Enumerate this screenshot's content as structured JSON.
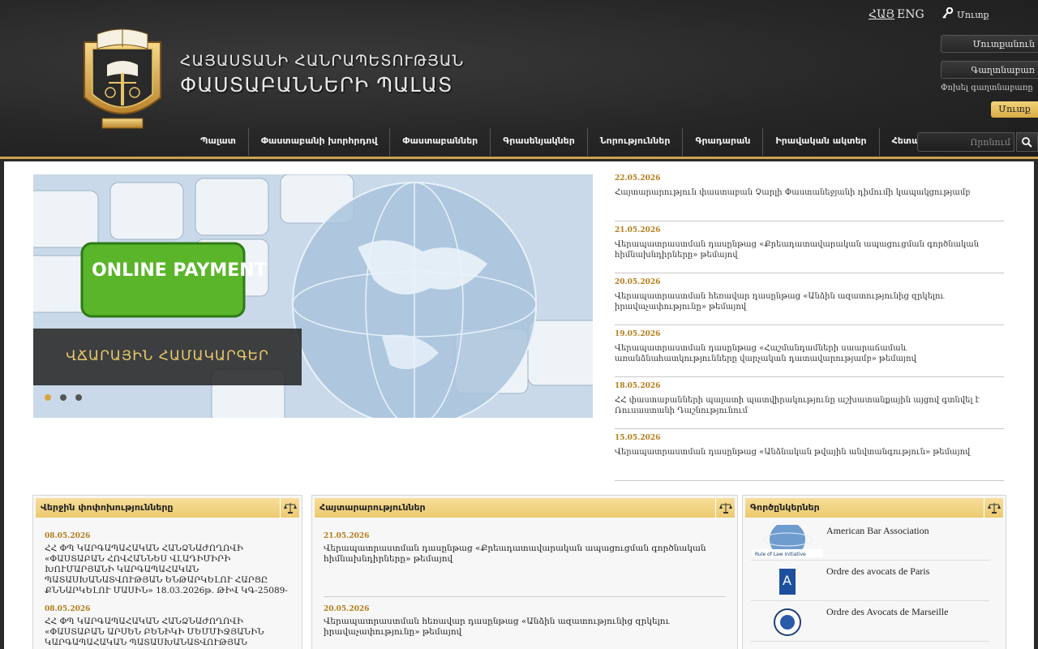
{
  "header": {
    "title_line1": "ՀԱՅԱՍՏԱՆԻ ՀԱՆՐԱՊԵՏՈՒԹՅԱՆ",
    "title_line2": "ՓԱՍՏԱԲԱՆՆԵՐԻ ՊԱԼԱՏ",
    "lang_hy": "ՀԱՅ",
    "lang_en": "ENG",
    "login_top": "Մուտք",
    "login_field": "Մուտքանուն",
    "password_field": "Գաղտնաբառ",
    "forgot": "Փոխել գաղտնաբառը",
    "enter_button": "Մուտք",
    "search_placeholder": "Որոնում"
  },
  "nav": [
    "Պալատ",
    "Փաստաբանի խորհրդով",
    "Փաստաբաններ",
    "Գրասենյակներ",
    "Նորություններ",
    "Գրադարան",
    "Իրավական ակտեր",
    "Հետադարձ կապ"
  ],
  "slider": {
    "caption": "ՎՃԱՐԱՅԻՆ ՀԱՄԱԿԱՐԳԵՐ",
    "keyboard_text": "ONLINE PAYMENT",
    "slides_count": 3,
    "active_slide": 1
  },
  "news": [
    {
      "date": "22.05.2026",
      "title": "Հայտարարություն փաստաբան Չարլի Փաստանեջյանի դիմումի կապակցությամբ"
    },
    {
      "date": "21.05.2026",
      "title": "Վերապատրաստման դասընթաց «Քրեադատավարական ապացուցման գործնական հիմնախնդիրները» թեմայով"
    },
    {
      "date": "20.05.2026",
      "title": "Վերապատրաստման հեռավար դասընթաց «Անձին ազատությունից զրկելու իրավաչափությունը» թեմայով"
    },
    {
      "date": "19.05.2026",
      "title": "Վերապատրաստման դասընթաց «Հաշմանդամների սաարաճամաև առանձնահատկությունները վարչական դատավարությամբ» թեմայով"
    },
    {
      "date": "18.05.2026",
      "title": "ՀՀ փաստաբանների պալատի պատվիրակությունը աշխատանքային այցով գտնվել է Ռուսաստանի Դաշնությունում"
    },
    {
      "date": "15.05.2026",
      "title": "Վերապատրաստման դասընթաց «Անձնական թվային անվտանգություն» թեմայով"
    }
  ],
  "panels": {
    "changes": {
      "title": "Վերջին փոփոխությունները",
      "items": [
        {
          "date": "08.05.2026",
          "text": "ՀՀ ՓՊ ԿԱՐԳԱՊԱՀԱԿԱՆ ՀԱՆՁՆԱԺՈՂՈՎԻ «ՓԱՍՏԱԲԱՆ ՀՈՎՀԱՆՆԵՍ ՎԼԱԴԻՄԻՐԻ ԽՈՒՄԱՐՅԱՆԻ ԿԱՐԳԱՊԱՀԱԿԱՆ ՊԱՏԱՍԽԱՆԱՏՎՈՒԹՅԱՆ ԵՆԹԱՐԿԵԼՈՒ ՀԱՐՑԸ ՔՆՆԱՐԿԵԼՈՒ ՄԱՍԻՆ» 18.03.2026թ. ԹԻՎ ԿԳ-25089-"
        },
        {
          "date": "08.05.2026",
          "text": "ՀՀ ՓՊ ԿԱՐԳԱՊԱՀԱԿԱՆ ՀԱՆՁՆԱԺՈՂՈՎԻ «ՓԱՍՏԱԲԱՆ ԱՐՍԵՆ ԲԵՆԻԿԻ ՄԵՄՄԻՋՅԱՆԻՆ ԿԱՐԳԱՊԱՀԱԿԱՆ ՊԱՏԱՍԽԱՆԱՏՎՈՒԹՅԱՆ"
        }
      ]
    },
    "announcements": {
      "title": "Հայտարարություններ",
      "items": [
        {
          "date": "21.05.2026",
          "text": "Վերապատրաստման դասընթաց «Քրեադատավարական ապացուցման գործնական հիմնախնդիրները» թեմայով"
        },
        {
          "date": "20.05.2026",
          "text": "Վերապատրաստման հեռավար դասընթաց «Անձին ազատությունից զրկելու իրավաչափությունը» թեմայով"
        }
      ]
    },
    "partners": {
      "title": "Գործընկերներ",
      "items": [
        {
          "name": "American Bar Association",
          "logo_text": "Rule of Law Initiative"
        },
        {
          "name": "Ordre des avocats de Paris",
          "logo_text": "A"
        },
        {
          "name": "Ordre des Avocats de Marseille",
          "logo_text": ""
        }
      ]
    }
  },
  "colors": {
    "accent_gold": "#d9ab45",
    "date_color": "#b27d1a",
    "header_bg": "#262626"
  }
}
